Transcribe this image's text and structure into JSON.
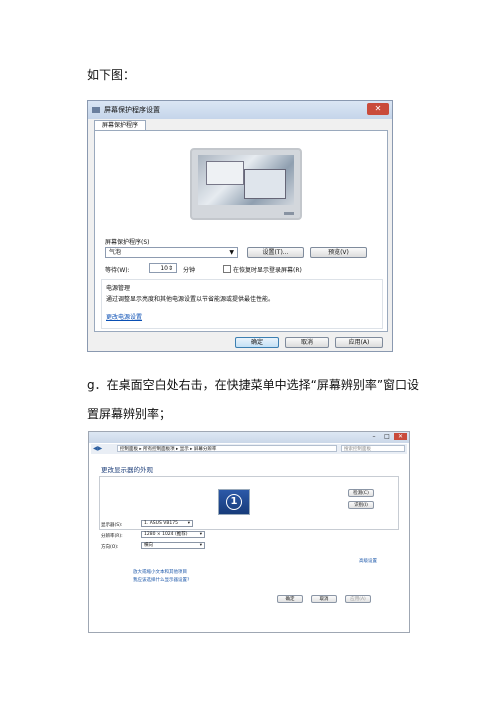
{
  "intro": "如下图：",
  "step_g_line1": "g．在桌面空白处右击，在快捷菜单中选择“屏幕辨别率”窗口设",
  "step_g_line2": "置屏幕辨别率；",
  "screensaver_dialog": {
    "title": "屏幕保护程序设置",
    "tab": "屏幕保护程序",
    "section_label": "屏幕保护程序(S)",
    "saver_value": "气泡",
    "settings_button": "设置(T)...",
    "preview_button": "预览(V)",
    "wait_label": "等待(W):",
    "wait_value": "10",
    "wait_unit": "分钟",
    "resume_checkbox": "在恢复时显示登录屏幕(R)",
    "power_title": "电源管理",
    "power_text": "通过调整显示亮度和其他电源设置以节省能源或提供最佳性能。",
    "power_link": "更改电源设置",
    "ok": "确定",
    "cancel": "取消",
    "apply": "应用(A)"
  },
  "resolution_window": {
    "breadcrumb": "控制面板 ▸ 所有控制面板项 ▸ 显示 ▸ 屏幕分辨率",
    "search_placeholder": "搜索控制面板",
    "heading": "更改显示器的外观",
    "monitor_number": "1",
    "detect_button": "检测(C)",
    "identify_button": "识别(I)",
    "display_label": "显示器(S):",
    "display_value": "1. ASUS VB175",
    "resolution_label": "分辨率(R):",
    "resolution_value": "1280 × 1024 (推荐)",
    "orientation_label": "方向(O):",
    "orientation_value": "横向",
    "advanced_link": "高级设置",
    "link1": "放大或缩小文本和其他项目",
    "link2": "我应该选择什么显示器设置?",
    "ok": "确定",
    "cancel": "取消",
    "apply": "应用(A)"
  }
}
